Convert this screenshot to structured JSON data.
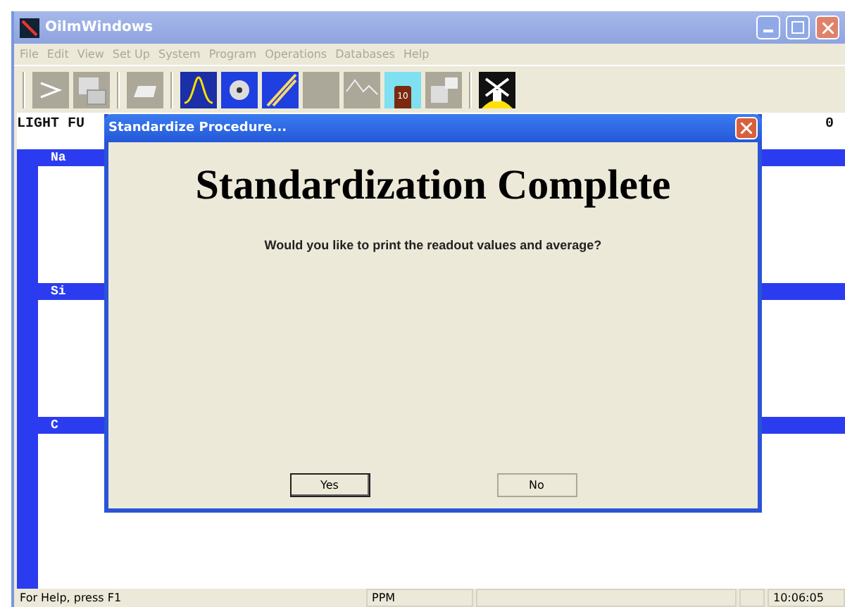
{
  "window": {
    "title": "OilmWindows"
  },
  "menu": [
    "File",
    "Edit",
    "View",
    "Set Up",
    "System",
    "Program",
    "Operations",
    "Databases",
    "Help"
  ],
  "toolbar": [
    [
      {
        "kind": "arrow",
        "enabled": false
      },
      {
        "kind": "document",
        "enabled": false
      }
    ],
    [
      {
        "kind": "tray",
        "enabled": false
      }
    ],
    [
      {
        "kind": "bell-curve",
        "enabled": true
      },
      {
        "kind": "disc",
        "enabled": true
      },
      {
        "kind": "diagonal",
        "enabled": true
      },
      {
        "kind": "blank",
        "enabled": false
      },
      {
        "kind": "line-chart",
        "enabled": false
      },
      {
        "kind": "bottle",
        "enabled": true,
        "label": "10"
      },
      {
        "kind": "computer",
        "enabled": false
      }
    ],
    [
      {
        "kind": "windmill",
        "enabled": true
      }
    ]
  ],
  "readout": {
    "header": "LIGHT FU",
    "value": "0",
    "elements": [
      "Na",
      "Si",
      "C"
    ]
  },
  "dialog": {
    "title": "Standardize Procedure...",
    "heading": "Standardization Complete",
    "question": "Would you like to print the readout values and average?",
    "buttons": [
      {
        "label": "Yes",
        "default": true
      },
      {
        "label": "No",
        "default": false
      }
    ]
  },
  "status_bar": {
    "help": "For Help, press F1",
    "unit": "PPM",
    "time": "10:06:05"
  }
}
